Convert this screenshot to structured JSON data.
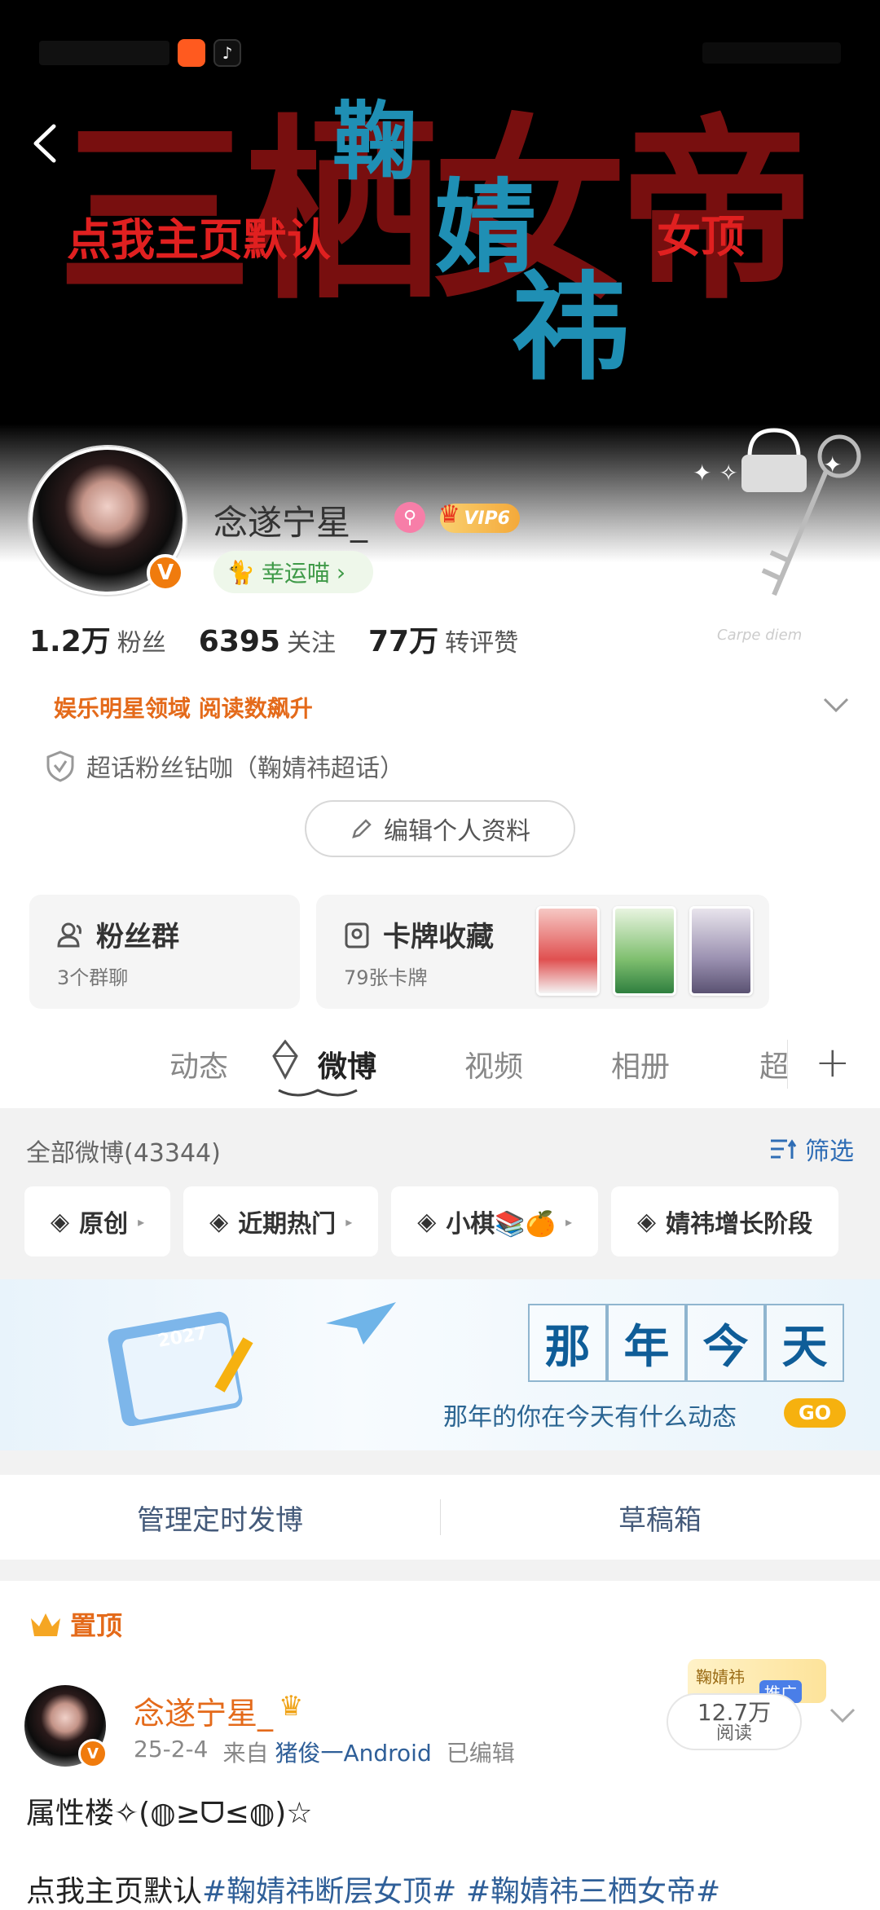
{
  "banner": {
    "big_text": "三栖女帝",
    "left_text": "点我主页默认",
    "right_text": "女顶",
    "name_1": "鞠",
    "name_2": "婧",
    "name_3": "祎"
  },
  "profile": {
    "username": "念遂宁星_",
    "vip_label": "VIP6",
    "lucky_label": "幸运喵",
    "stats": [
      {
        "value": "1.2万",
        "label": "粉丝"
      },
      {
        "value": "6395",
        "label": "关注"
      },
      {
        "value": "77万",
        "label": "转评赞"
      }
    ],
    "honor": "娱乐明星领域 阅读数飙升",
    "super_topic": "超话粉丝钻咖（鞠婧祎超话）",
    "edit_label": "编辑个人资料"
  },
  "boxes": {
    "fans_title": "粉丝群",
    "fans_sub": "3个群聊",
    "cards_title": "卡牌收藏",
    "cards_sub": "79张卡牌"
  },
  "tabs": [
    "动态",
    "微博",
    "视频",
    "相册",
    "超"
  ],
  "feed": {
    "all_posts": "全部微博(43344)",
    "filter_label": "筛选",
    "chips": [
      "原创",
      "近期热门",
      "小棋📚🍊",
      "婧祎增长阶段"
    ]
  },
  "memory": {
    "title_chars": [
      "那",
      "年",
      "今",
      "天"
    ],
    "subtitle": "那年的你在今天有什么动态",
    "go_label": "GO",
    "calendar_year": "2027"
  },
  "manage": {
    "left": "管理定时发博",
    "right": "草稿箱"
  },
  "post": {
    "pinned_label": "置顶",
    "author": "念遂宁星_",
    "date": "25-2-4",
    "source_prefix": "来自",
    "source": "猪俊一Android",
    "edited": "已编辑",
    "badge_card": "鞠婧祎",
    "promo": "推广",
    "reads_value": "12.7万",
    "reads_label": "阅读",
    "text1": "属性楼✧(◍≥ᗜ≤◍)☆",
    "text2_prefix": "点我主页默认",
    "text2_tag1": "#鞠婧祎断层女顶#",
    "text2_tag2": "#鞠婧祎三栖女帝#"
  },
  "colors": {
    "accent_orange": "#e46a1a",
    "link_blue": "#2f5f98",
    "banner_red": "#8e1212",
    "banner_blue": "#1f8fb4"
  }
}
